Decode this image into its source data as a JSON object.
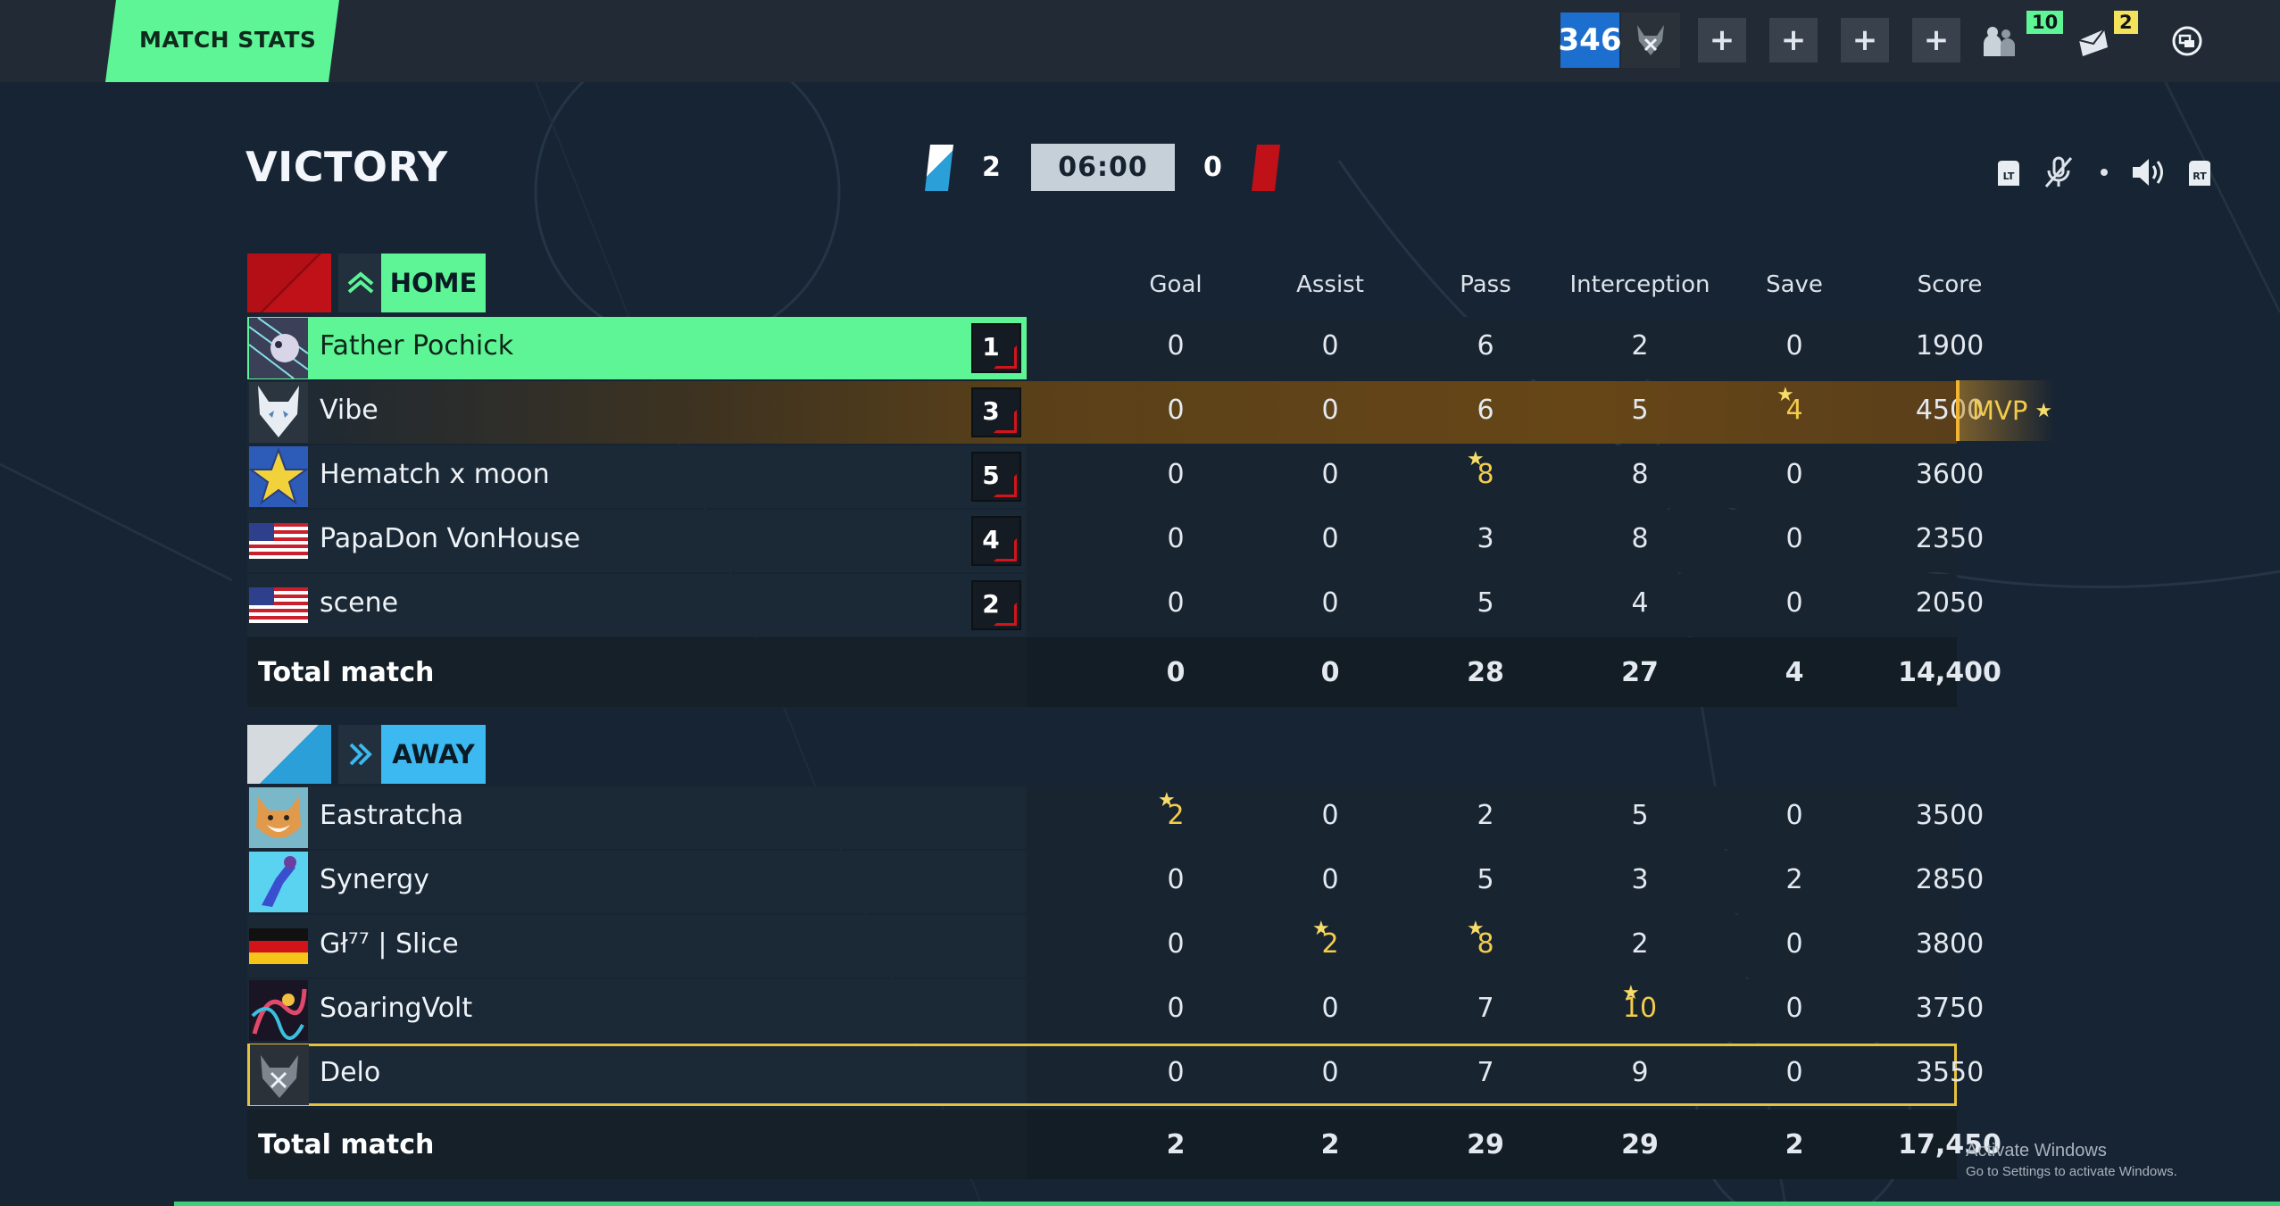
{
  "topbar": {
    "tab_label": "MATCH STATS",
    "level": "346",
    "plus_buttons": [
      "+",
      "+",
      "+",
      "+"
    ],
    "friends_count": "10",
    "notifications_count": "2"
  },
  "header": {
    "result": "VICTORY",
    "home_score": "2",
    "timer": "06:00",
    "away_score": "0"
  },
  "columns": [
    "Goal",
    "Assist",
    "Pass",
    "Interception",
    "Save",
    "Score"
  ],
  "home": {
    "label": "HOME",
    "players": [
      {
        "name": "Father Pochick",
        "rank": "1",
        "goal": "0",
        "assist": "0",
        "pass": "6",
        "interception": "2",
        "save": "0",
        "score": "1900"
      },
      {
        "name": "Vibe",
        "rank": "3",
        "goal": "0",
        "assist": "0",
        "pass": "6",
        "interception": "5",
        "save": "4",
        "score": "4500"
      },
      {
        "name": "Hematch x moon",
        "rank": "5",
        "goal": "0",
        "assist": "0",
        "pass": "8",
        "interception": "8",
        "save": "0",
        "score": "3600"
      },
      {
        "name": "PapaDon VonHouse",
        "rank": "4",
        "goal": "0",
        "assist": "0",
        "pass": "3",
        "interception": "8",
        "save": "0",
        "score": "2350"
      },
      {
        "name": "scene",
        "rank": "2",
        "goal": "0",
        "assist": "0",
        "pass": "5",
        "interception": "4",
        "save": "0",
        "score": "2050"
      }
    ],
    "total": {
      "label": "Total match",
      "goal": "0",
      "assist": "0",
      "pass": "28",
      "interception": "27",
      "save": "4",
      "score": "14,400"
    }
  },
  "away": {
    "label": "AWAY",
    "players": [
      {
        "name": "Eastratcha",
        "goal": "2",
        "assist": "0",
        "pass": "2",
        "interception": "5",
        "save": "0",
        "score": "3500"
      },
      {
        "name": "Synergy",
        "goal": "0",
        "assist": "0",
        "pass": "5",
        "interception": "3",
        "save": "2",
        "score": "2850"
      },
      {
        "name": "Gł⁷⁷ | Slice",
        "goal": "0",
        "assist": "2",
        "pass": "8",
        "interception": "2",
        "save": "0",
        "score": "3800"
      },
      {
        "name": "SoaringVolt",
        "goal": "0",
        "assist": "0",
        "pass": "7",
        "interception": "10",
        "save": "0",
        "score": "3750"
      },
      {
        "name": "Delo",
        "goal": "0",
        "assist": "0",
        "pass": "7",
        "interception": "9",
        "save": "0",
        "score": "3550"
      }
    ],
    "total": {
      "label": "Total match",
      "goal": "2",
      "assist": "2",
      "pass": "29",
      "interception": "29",
      "save": "2",
      "score": "17,450"
    }
  },
  "mvp_label": "MVP",
  "activation": {
    "title": "Activate Windows",
    "subtitle": "Go to Settings to activate Windows."
  },
  "icons": [
    "mute-avatar-icon",
    "friends-icon",
    "mail-icon",
    "menu-icon",
    "lt-icon",
    "mic-muted-icon",
    "dot-icon",
    "volume-icon",
    "rt-icon",
    "chevron-up-emblem-icon",
    "chevron-right-emblem-icon",
    "star-icon"
  ],
  "colors": {
    "home_accent": "#5ef596",
    "away_accent": "#3cb9f0",
    "mvp_gold": "#f3cc4b",
    "level_blue": "#1d6fcf",
    "rank_red": "#d2141c"
  }
}
